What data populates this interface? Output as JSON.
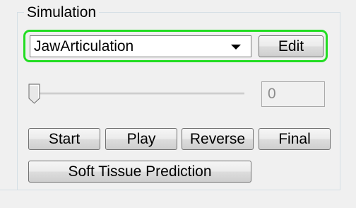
{
  "simulation_panel": {
    "title": "Simulation",
    "dropdown": {
      "selected": "JawArticulation"
    },
    "edit_label": "Edit",
    "slider": {
      "level": 0.0
    },
    "value_field": {
      "value": "0"
    },
    "buttons": {
      "start": "Start",
      "play": "Play",
      "reverse": "Reverse",
      "final": "Final",
      "soft_tissue": "Soft Tissue Prediction"
    },
    "highlight_color": "#22dd22"
  }
}
